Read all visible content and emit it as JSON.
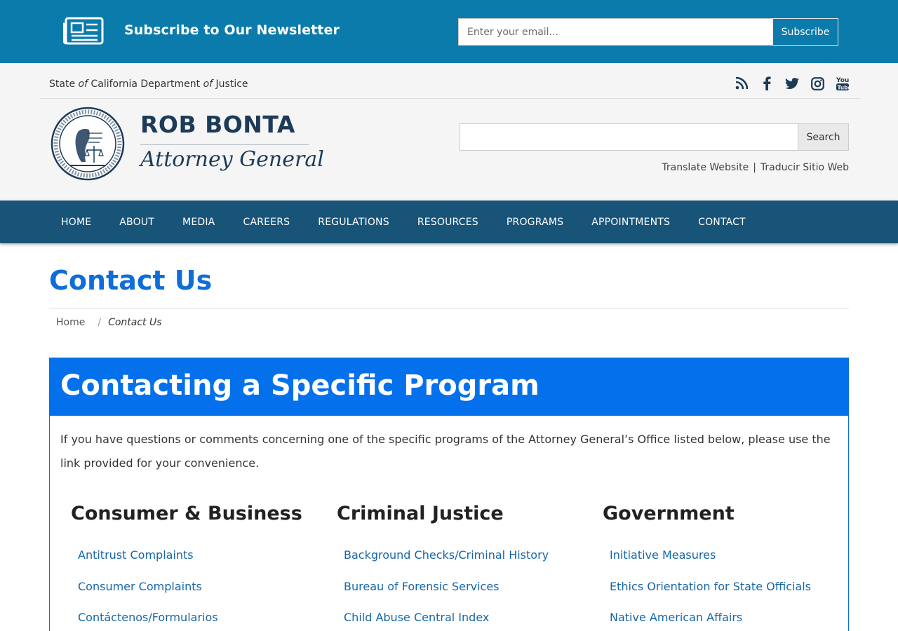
{
  "newsletter": {
    "title": "Subscribe to Our Newsletter",
    "email_placeholder": "Enter your email...",
    "subscribe_label": "Subscribe"
  },
  "header": {
    "org_parts": [
      "State ",
      "of",
      " California Department ",
      "of",
      " Justice"
    ],
    "social_icons": [
      "rss-icon",
      "facebook-icon",
      "twitter-icon",
      "instagram-icon",
      "youtube-icon"
    ],
    "name": "ROB BONTA",
    "title": "Attorney General",
    "search_label": "Search",
    "search_value": "",
    "translate_en": "Translate Website",
    "translate_sep": "|",
    "translate_es": "Traducir Sitio Web"
  },
  "nav": {
    "items": [
      "HOME",
      "ABOUT",
      "MEDIA",
      "CAREERS",
      "REGULATIONS",
      "RESOURCES",
      "PROGRAMS",
      "APPOINTMENTS",
      "CONTACT"
    ]
  },
  "page": {
    "title": "Contact Us",
    "breadcrumb_home": "Home",
    "breadcrumb_sep": "/",
    "breadcrumb_current": "Contact Us"
  },
  "program_box": {
    "heading": "Contacting a Specific Program",
    "intro": "If you have questions or comments concerning one of the specific programs of the Attorney General’s Office listed below, please use the link provided for your convenience.",
    "columns": [
      {
        "title": "Consumer & Business",
        "links": [
          "Antitrust Complaints",
          "Consumer Complaints",
          "Contáctenos/Formularios"
        ]
      },
      {
        "title": "Criminal Justice",
        "links": [
          "Background Checks/Criminal History",
          "Bureau of Forensic Services",
          "Child Abuse Central Index"
        ]
      },
      {
        "title": "Government",
        "links": [
          "Initiative Measures",
          "Ethics Orientation for State Officials",
          "Native American Affairs"
        ]
      }
    ]
  },
  "colors": {
    "newsletter_bg": "#0b7bab",
    "nav_bg": "#185378",
    "accent_blue": "#0570eb",
    "link_blue": "#1566a8"
  }
}
